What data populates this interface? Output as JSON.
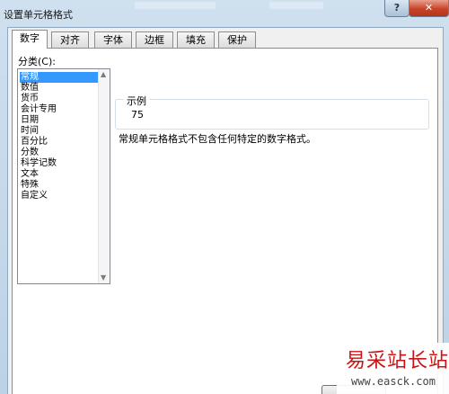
{
  "window": {
    "title": "设置单元格格式"
  },
  "tabs": [
    {
      "label": "数字",
      "active": true
    },
    {
      "label": "对齐",
      "active": false
    },
    {
      "label": "字体",
      "active": false
    },
    {
      "label": "边框",
      "active": false
    },
    {
      "label": "填充",
      "active": false
    },
    {
      "label": "保护",
      "active": false
    }
  ],
  "category": {
    "label": "分类(C):",
    "selected": "常规",
    "items": [
      "常规",
      "数值",
      "货币",
      "会计专用",
      "日期",
      "时间",
      "百分比",
      "分数",
      "科学记数",
      "文本",
      "特殊",
      "自定义"
    ]
  },
  "sample": {
    "label": "示例",
    "value": "75"
  },
  "description": "常规单元格格式不包含任何特定的数字格式。",
  "watermark": {
    "name": "易采站长站",
    "url": "www.easck.com"
  },
  "icons": {
    "help": "help-icon",
    "close": "close-icon",
    "scroll_up": "chevron-up-icon",
    "scroll_down": "chevron-down-icon"
  },
  "colors": {
    "selection": "#3399ff",
    "close_button": "#c8432a",
    "watermark_text": "#c81414"
  }
}
